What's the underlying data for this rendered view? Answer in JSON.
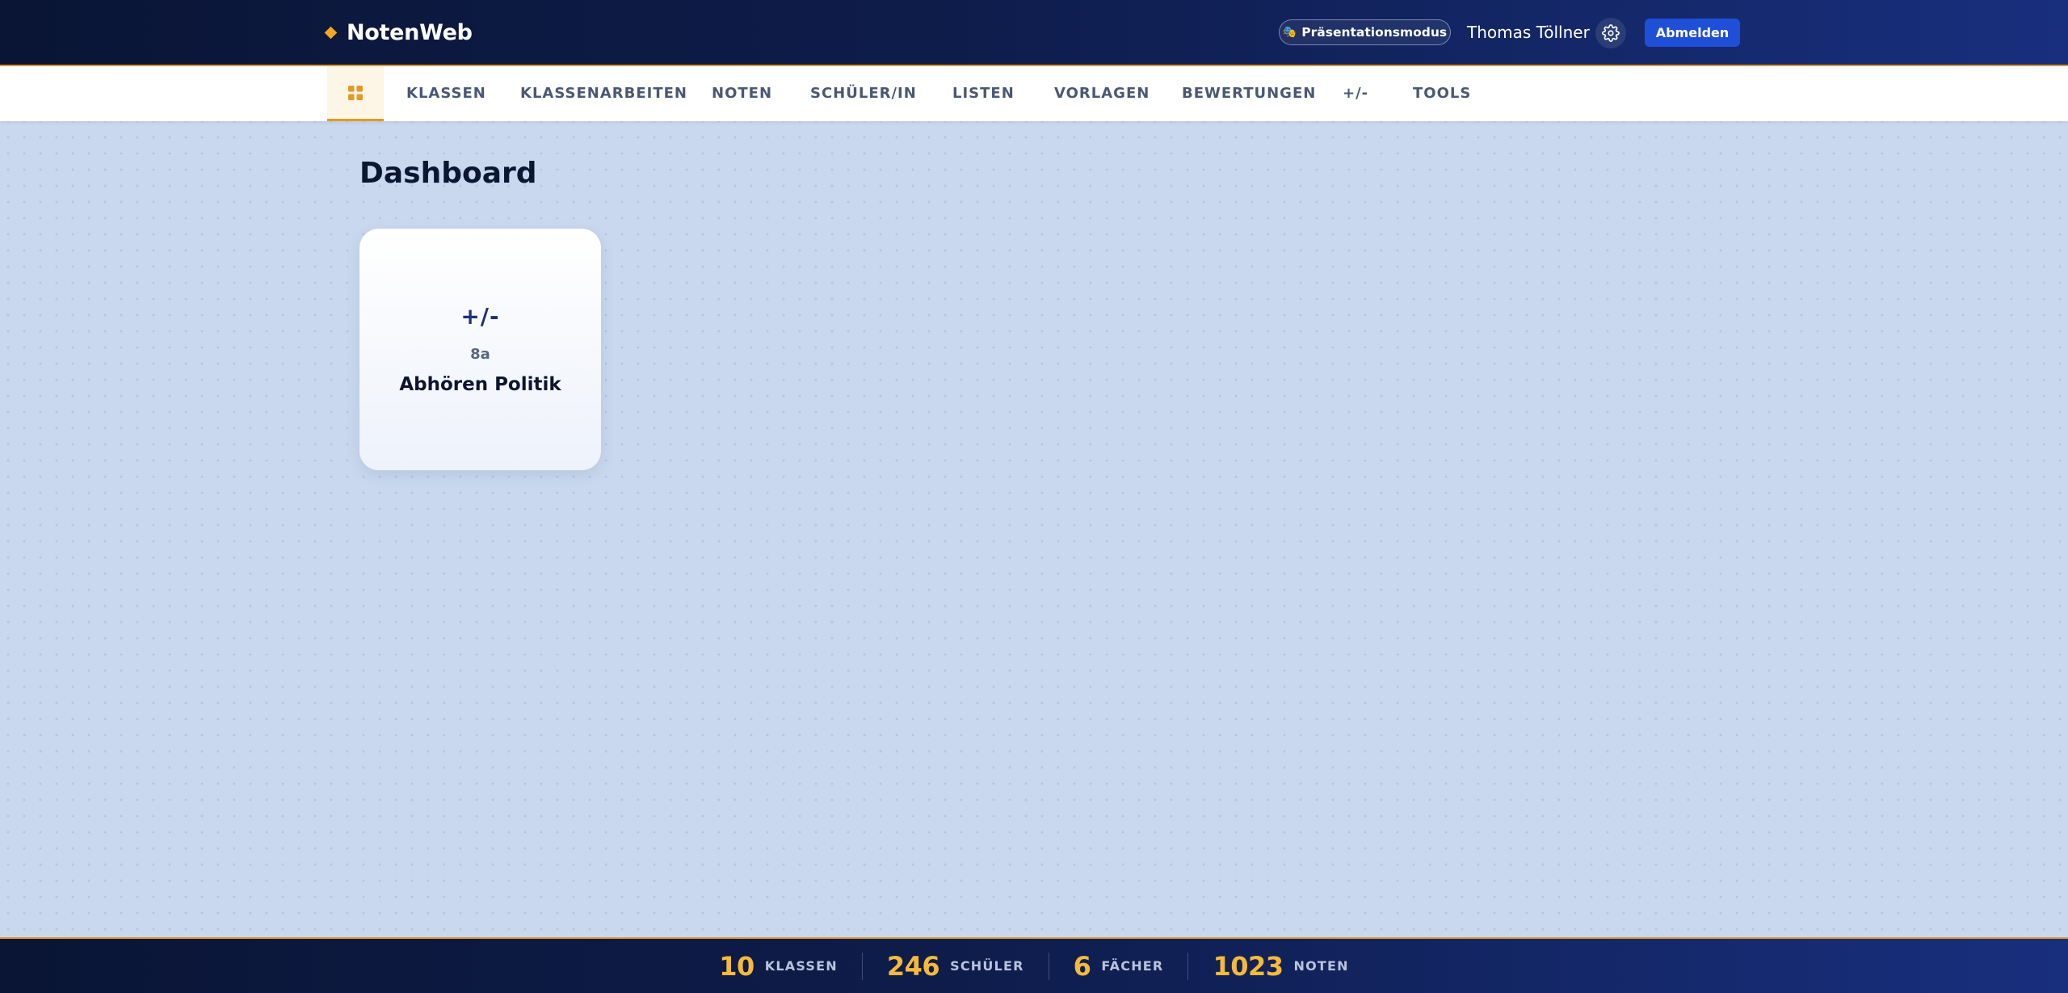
{
  "header": {
    "app_name": "NotenWeb",
    "presentation_mode_label": "Präsentationsmodus",
    "user_name": "Thomas Töllner",
    "logout_label": "Abmelden"
  },
  "nav": {
    "home_icon": "grid-icon",
    "items": [
      {
        "label": "KLASSEN"
      },
      {
        "label": "KLASSENARBEITEN"
      },
      {
        "label": "NOTEN"
      },
      {
        "label": "SCHÜLER/IN"
      },
      {
        "label": "LISTEN"
      },
      {
        "label": "VORLAGEN"
      },
      {
        "label": "BEWERTUNGEN"
      },
      {
        "label": "+/-"
      },
      {
        "label": "TOOLS"
      }
    ]
  },
  "main": {
    "title": "Dashboard",
    "cards": [
      {
        "title": "+/-",
        "class_name": "8a",
        "subject": "Abhören Politik"
      }
    ]
  },
  "footer": {
    "stats": [
      {
        "value": "10",
        "label": "KLASSEN"
      },
      {
        "value": "246",
        "label": "SCHÜLER"
      },
      {
        "value": "6",
        "label": "FÄCHER"
      },
      {
        "value": "1023",
        "label": "NOTEN"
      }
    ]
  },
  "colors": {
    "header_gradient_start": "#0a1535",
    "header_gradient_end": "#182f7e",
    "accent_orange": "#f5a524",
    "stat_number": "#f5b93c",
    "logout_button": "#1f4fd6",
    "page_background": "#c9d8ee"
  }
}
